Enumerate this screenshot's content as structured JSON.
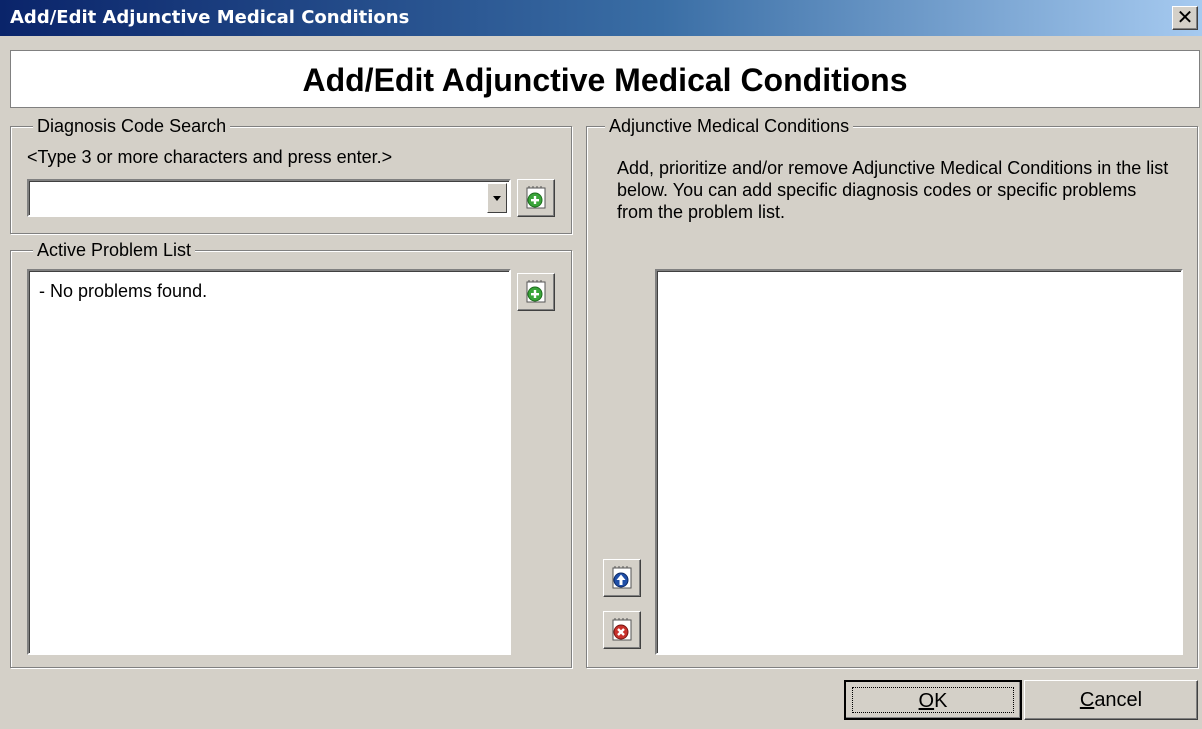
{
  "window": {
    "title": "Add/Edit Adjunctive Medical Conditions",
    "close_glyph": "✕"
  },
  "header": {
    "title": "Add/Edit Adjunctive Medical Conditions"
  },
  "diagnosis_search": {
    "legend": "Diagnosis Code Search",
    "hint": "<Type 3 or more characters and press enter.>",
    "value": "",
    "add_icon": "add-note-icon"
  },
  "problem_list": {
    "legend": "Active Problem List",
    "items": [
      "- No problems found."
    ],
    "add_icon": "add-note-icon"
  },
  "conditions": {
    "legend": "Adjunctive Medical Conditions",
    "instructions": "Add, prioritize and/or remove Adjunctive Medical Conditions in the list below.  You can add specific diagnosis codes or specific problems from the problem list.",
    "items": [],
    "move_up_icon": "move-up-icon",
    "remove_icon": "remove-icon"
  },
  "buttons": {
    "ok_accel": "O",
    "ok_rest": "K",
    "cancel_accel": "C",
    "cancel_rest": "ancel"
  },
  "colors": {
    "dialog_bg": "#d4d0c8",
    "title_start": "#0a246a",
    "title_end": "#a6caf0",
    "add_green": "#3aa53a",
    "up_blue": "#1f4fa8",
    "remove_red": "#c8322d"
  }
}
